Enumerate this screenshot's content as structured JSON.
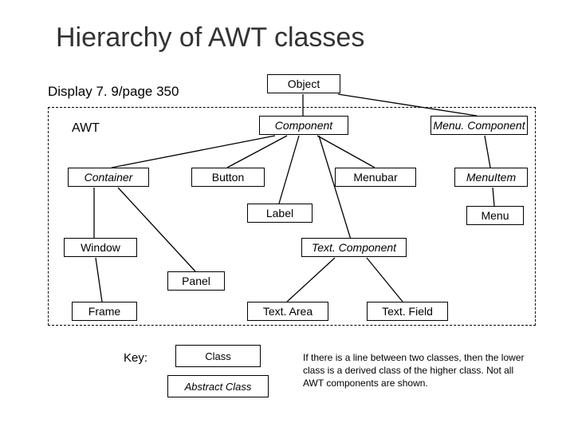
{
  "title": "Hierarchy of AWT classes",
  "subtitle": "Display 7. 9/page 350",
  "region_label": "AWT",
  "nodes": {
    "object": "Object",
    "component": "Component",
    "menu_component": "Menu. Component",
    "container": "Container",
    "button": "Button",
    "menubar": "Menubar",
    "menu_item": "MenuItem",
    "label": "Label",
    "window": "Window",
    "text_component": "Text. Component",
    "menu": "Menu",
    "panel": "Panel",
    "frame": "Frame",
    "text_area": "Text. Area",
    "text_field": "Text. Field"
  },
  "key": {
    "label": "Key:",
    "class": "Class",
    "abstract_class": "Abstract Class"
  },
  "caption": "If there is a line between two classes, then the lower class is a derived class of the higher class. Not all AWT components are shown.",
  "chart_data": {
    "type": "diagram",
    "title": "Hierarchy of AWT classes",
    "region": "AWT (dashed boundary encloses all AWT classes)",
    "node_types": {
      "abstract": [
        "Component",
        "Container",
        "Menu.Component",
        "MenuItem",
        "Text.Component"
      ],
      "concrete": [
        "Object",
        "Button",
        "Menubar",
        "Label",
        "Window",
        "Menu",
        "Panel",
        "Frame",
        "Text.Area",
        "Text.Field"
      ]
    },
    "edges_child_to_parent": [
      [
        "Component",
        "Object"
      ],
      [
        "Menu.Component",
        "Object"
      ],
      [
        "Container",
        "Component"
      ],
      [
        "Button",
        "Component"
      ],
      [
        "Menubar",
        "Component"
      ],
      [
        "Label",
        "Component"
      ],
      [
        "Text.Component",
        "Component"
      ],
      [
        "MenuItem",
        "Menu.Component"
      ],
      [
        "Menu",
        "MenuItem"
      ],
      [
        "Window",
        "Container"
      ],
      [
        "Panel",
        "Container"
      ],
      [
        "Frame",
        "Window"
      ],
      [
        "Text.Area",
        "Text.Component"
      ],
      [
        "Text.Field",
        "Text.Component"
      ]
    ],
    "legend": {
      "Class": "concrete class (plain box)",
      "Abstract Class": "abstract class (italic label box)"
    },
    "note": "If there is a line between two classes, then the lower class is a derived class of the higher class. Not all AWT components are shown."
  }
}
